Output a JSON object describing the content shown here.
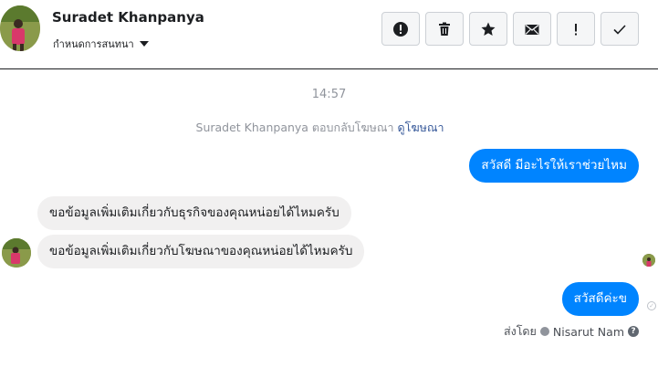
{
  "header": {
    "contact_name": "Suradet Khanpanya",
    "convo_menu_label": "กำหนดการสนทนา",
    "toolbar": [
      {
        "icon": "alert-circle-icon",
        "name": "spam-button"
      },
      {
        "icon": "trash-icon",
        "name": "delete-button"
      },
      {
        "icon": "star-icon",
        "name": "star-button"
      },
      {
        "icon": "envelope-icon",
        "name": "mark-unread-button"
      },
      {
        "icon": "exclamation-icon",
        "name": "follow-up-button"
      },
      {
        "icon": "checkmark-icon",
        "name": "mark-done-button"
      }
    ]
  },
  "chat": {
    "timestamp": "14:57",
    "ad_reply_text": "Suradet Khanpanya ตอบกลับโฆษณา",
    "ad_link": "ดูโฆษณา",
    "messages": [
      {
        "direction": "out",
        "text": "สวัสดี มีอะไรให้เราช่วยไหม"
      },
      {
        "direction": "in",
        "text": "ขอข้อมูลเพิ่มเติมเกี่ยวกับธุรกิจของคุณหน่อยได้ไหมครับ"
      },
      {
        "direction": "in",
        "text": "ขอข้อมูลเพิ่มเติมเกี่ยวกับโฆษณาของคุณหน่อยได้ไหมครับ"
      },
      {
        "direction": "out",
        "text": "สวัสดีค่ะข"
      }
    ],
    "sent_by_label": "ส่งโดย",
    "sent_by_name": "Nisarut Nam"
  },
  "colors": {
    "outgoing_bubble": "#0084ff",
    "incoming_bubble": "#f1f0f0",
    "link": "#365899"
  }
}
